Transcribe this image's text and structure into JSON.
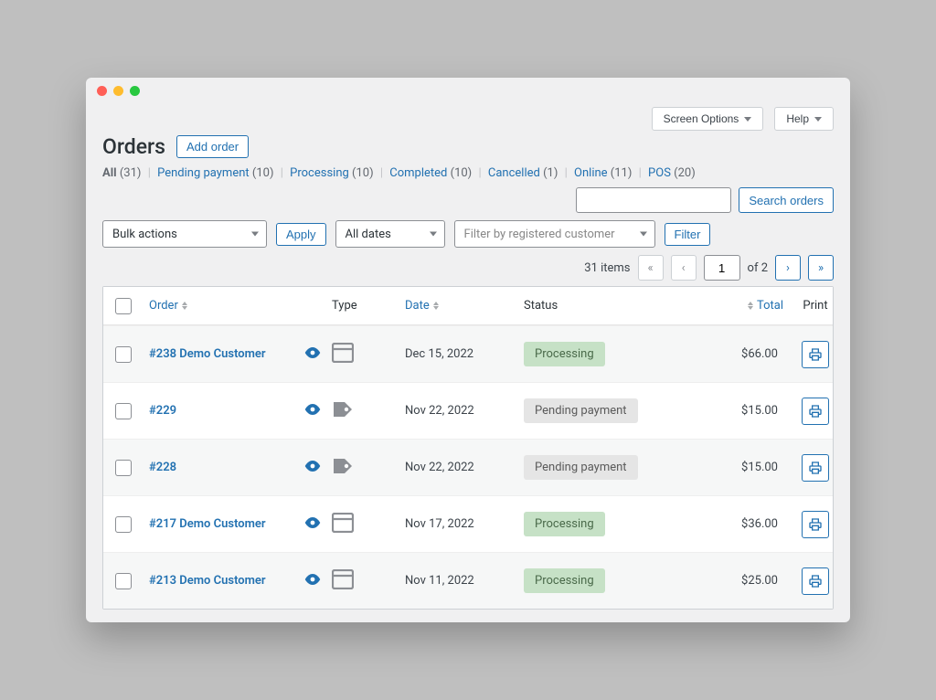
{
  "topButtons": {
    "screenOptions": "Screen Options",
    "help": "Help"
  },
  "page": {
    "title": "Orders",
    "addButton": "Add order"
  },
  "statusFilters": [
    {
      "label": "All",
      "count": "(31)",
      "active": true
    },
    {
      "label": "Pending payment",
      "count": "(10)"
    },
    {
      "label": "Processing",
      "count": "(10)"
    },
    {
      "label": "Completed",
      "count": "(10)"
    },
    {
      "label": "Cancelled",
      "count": "(1)"
    },
    {
      "label": "Online",
      "count": "(11)"
    },
    {
      "label": "POS",
      "count": "(20)"
    }
  ],
  "search": {
    "button": "Search orders"
  },
  "controls": {
    "bulk": "Bulk actions",
    "apply": "Apply",
    "dates": "All dates",
    "customer": "Filter by registered customer",
    "filter": "Filter"
  },
  "pagination": {
    "items": "31 items",
    "page": "1",
    "of": "of 2",
    "first": "«",
    "prev": "‹",
    "next": "›",
    "last": "»"
  },
  "columns": {
    "order": "Order",
    "type": "Type",
    "date": "Date",
    "status": "Status",
    "total": "Total",
    "print": "Print"
  },
  "rows": [
    {
      "order": "#238 Demo Customer",
      "typeIcon": "window",
      "date": "Dec 15, 2022",
      "status": "Processing",
      "statusClass": "processing",
      "total": "$66.00"
    },
    {
      "order": "#229",
      "typeIcon": "tag",
      "date": "Nov 22, 2022",
      "status": "Pending payment",
      "statusClass": "pending",
      "total": "$15.00"
    },
    {
      "order": "#228",
      "typeIcon": "tag",
      "date": "Nov 22, 2022",
      "status": "Pending payment",
      "statusClass": "pending",
      "total": "$15.00"
    },
    {
      "order": "#217 Demo Customer",
      "typeIcon": "window",
      "date": "Nov 17, 2022",
      "status": "Processing",
      "statusClass": "processing",
      "total": "$36.00"
    },
    {
      "order": "#213 Demo Customer",
      "typeIcon": "window",
      "date": "Nov 11, 2022",
      "status": "Processing",
      "statusClass": "processing",
      "total": "$25.00"
    }
  ]
}
